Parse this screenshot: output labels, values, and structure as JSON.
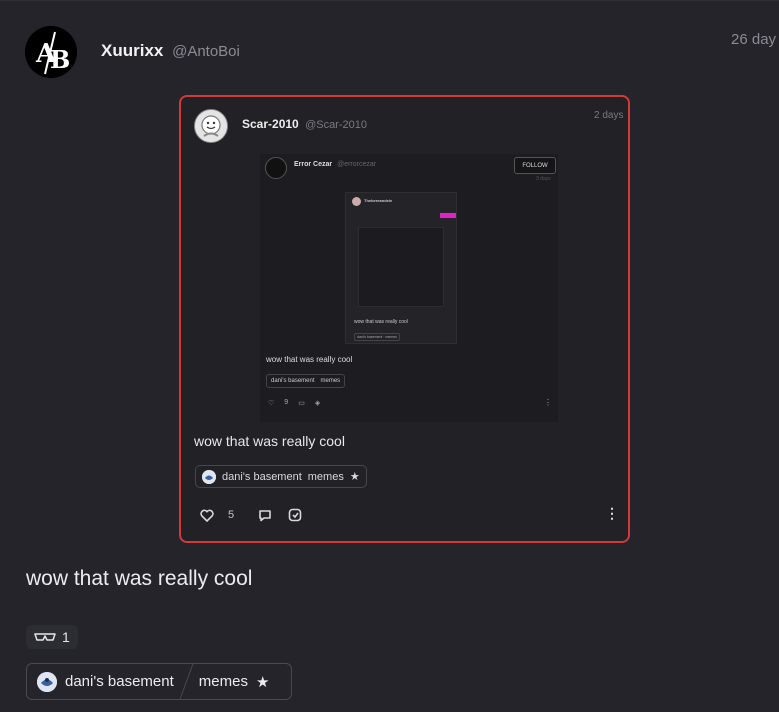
{
  "post": {
    "author_name": "Xuurixx",
    "author_handle": "@AntoBoi",
    "timestamp": "26 day",
    "avatar_text": "AB",
    "text": "wow that was really cool",
    "reaction_icon": "sunglasses-icon",
    "reaction_count": "1",
    "tag_community": "dani's basement",
    "tag_topic": "memes"
  },
  "quote": {
    "author_name": "Scar-2010",
    "author_handle": "@Scar-2010",
    "timestamp": "2 days",
    "text": "wow that was really cool",
    "tag_community": "dani's basement",
    "tag_topic": "memes",
    "like_count": "5",
    "border_color": "#d23a3a",
    "embedded": {
      "author_name": "Error Cezar",
      "author_handle": "@errorcezar",
      "follow_label": "FOLLOW",
      "timestamp": "3 days",
      "text": "wow that was really cool",
      "tag_community": "dani's basement",
      "tag_topic": "memes",
      "like_count": "9",
      "nested_author": "Thebeerandele",
      "nested_text": "wow that was really cool",
      "nested_tags": "dani's basement · memes"
    }
  },
  "colors": {
    "background": "#24242a",
    "accent_border": "#d23a3a",
    "muted_text": "#8b8b95"
  }
}
